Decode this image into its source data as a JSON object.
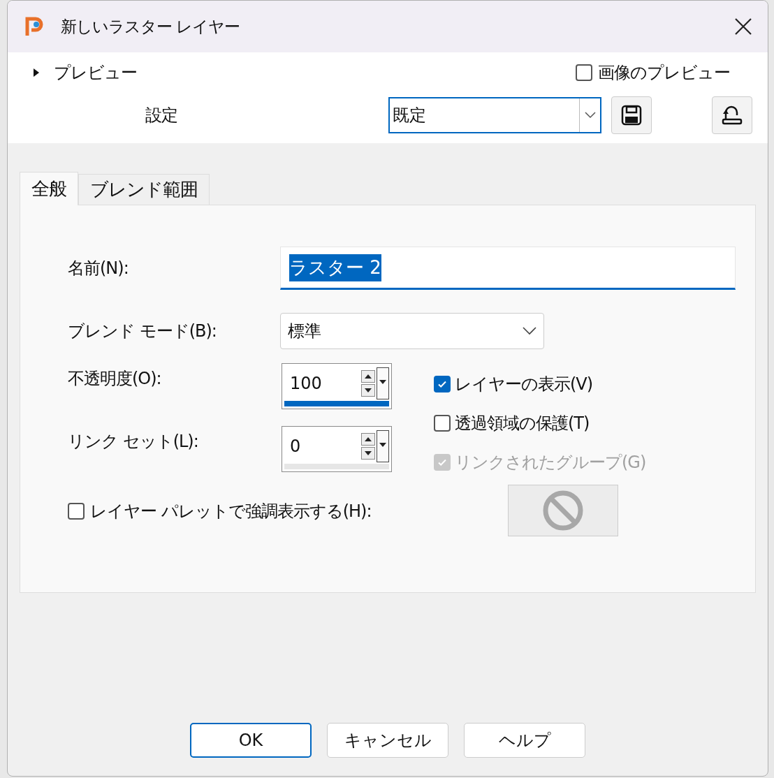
{
  "window": {
    "title": "新しいラスター レイヤー"
  },
  "preview": {
    "label": "プレビュー",
    "expanded": false
  },
  "image_preview": {
    "label": "画像のプレビュー",
    "checked": false
  },
  "settings": {
    "label": "設定",
    "value": "既定"
  },
  "tabs": [
    {
      "label": "全般",
      "selected": true
    },
    {
      "label": "ブレンド範囲",
      "selected": false
    }
  ],
  "name_field": {
    "label": "名前(N):",
    "value": "ラスター 2"
  },
  "blend_mode": {
    "label": "ブレンド モード(B):",
    "value": "標準"
  },
  "opacity": {
    "label": "不透明度(O):",
    "value": "100",
    "level": 1
  },
  "link_set": {
    "label": "リンク セット(L):",
    "value": "0",
    "level": 0
  },
  "options": [
    {
      "label": "レイヤーの表示(V)",
      "checked": true,
      "disabled": false
    },
    {
      "label": "透過領域の保護(T)",
      "checked": false,
      "disabled": false
    },
    {
      "label": "リンクされたグループ(G)",
      "checked": true,
      "disabled": true
    }
  ],
  "highlight": {
    "label": "レイヤー パレットで強調表示する(H):",
    "checked": false
  },
  "buttons": [
    {
      "label": "OK",
      "default": true
    },
    {
      "label": "キャンセル",
      "default": false
    },
    {
      "label": "ヘルプ",
      "default": false
    }
  ]
}
